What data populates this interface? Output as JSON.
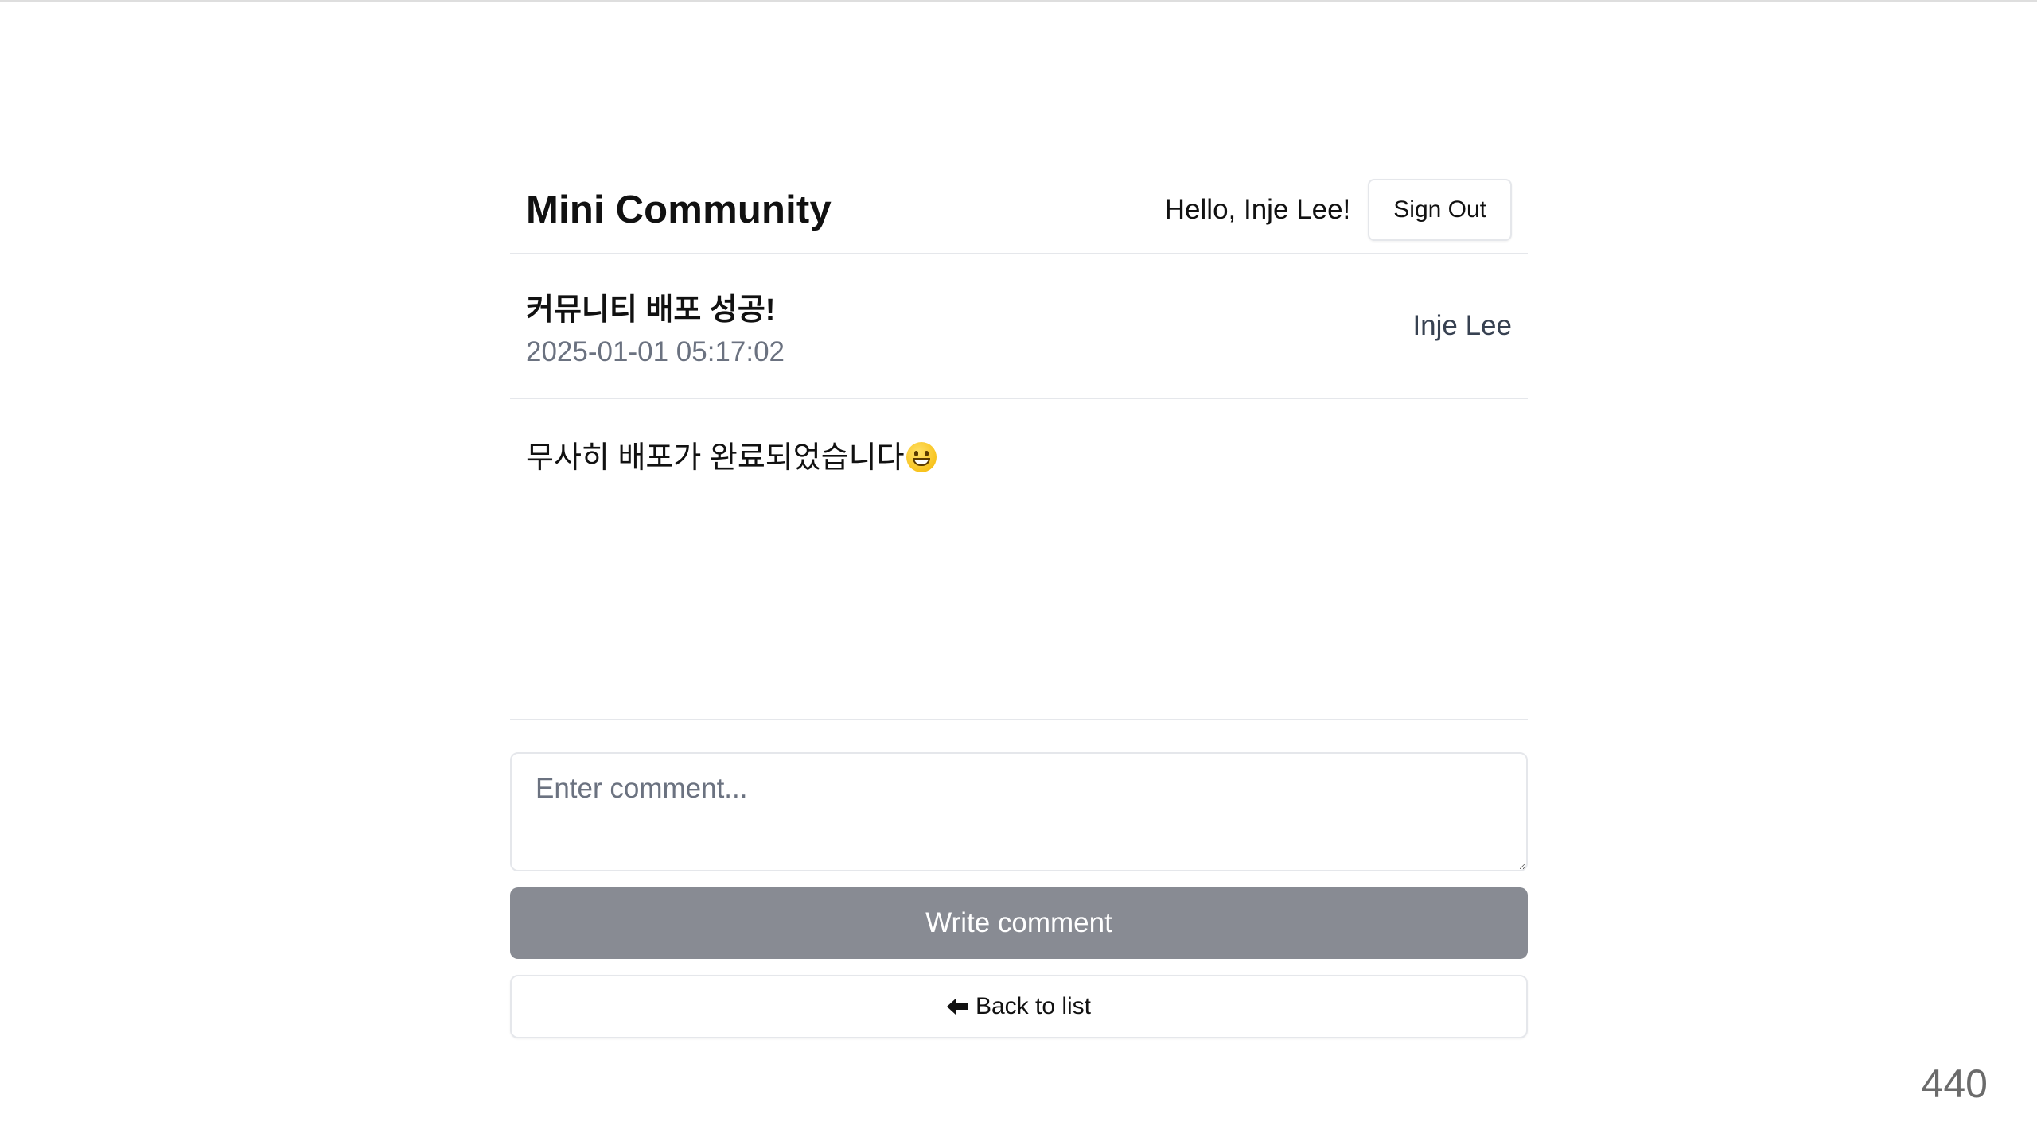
{
  "header": {
    "site_title": "Mini Community",
    "greeting": "Hello, Inje Lee!",
    "signout_label": "Sign Out"
  },
  "post": {
    "title": "커뮤니티 배포 성공!",
    "date": "2025-01-01 05:17:02",
    "author": "Inje Lee",
    "body": "무사히 배포가 완료되었습니다",
    "body_emoji": "grinning-face-emoji"
  },
  "comment_form": {
    "placeholder": "Enter comment...",
    "value": "",
    "submit_label": "Write comment",
    "submit_color": "#888b93"
  },
  "navigation": {
    "back_label": "Back to list",
    "back_icon": "arrow-left-icon"
  },
  "page_counter": "440"
}
